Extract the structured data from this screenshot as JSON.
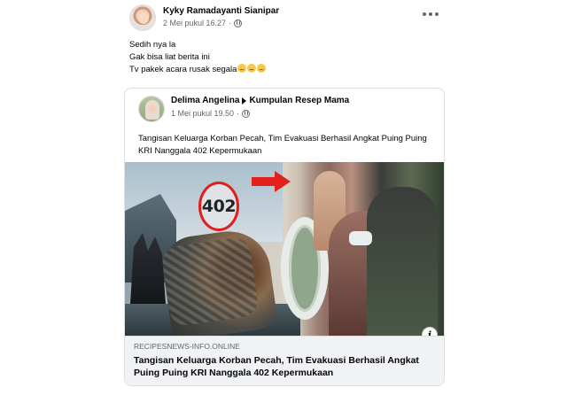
{
  "post": {
    "author": "Kyky Ramadayanti Sianipar",
    "timestamp": "2 Mei pukul 16.27",
    "privacy_icon": "globe-icon",
    "more_icon": "more-horizontal-icon",
    "lines": [
      "Sedih nya la",
      "Gak bisa liat berita ini",
      "Tv pakek acara rusak segala"
    ],
    "emojis": [
      "😔",
      "😔",
      "😔"
    ]
  },
  "shared_post": {
    "author": "Delima Angelina",
    "group": "Kumpulan Resep Mama",
    "timestamp": "1 Mei pukul 19.50",
    "text": "Tangisan Keluarga Korban Pecah, Tim Evakuasi Berhasil Angkat Puing Puing KRI Nanggala 402 Kepermukaan",
    "image": {
      "hull_number": "402",
      "info_icon": "i",
      "accent_color": "#e3211c"
    },
    "link": {
      "domain": "RECIPESNEWS-INFO.ONLINE",
      "title": "Tangisan Keluarga Korban Pecah, Tim Evakuasi Berhasil Angkat Puing Puing KRI Nanggala 402 Kepermukaan"
    }
  }
}
